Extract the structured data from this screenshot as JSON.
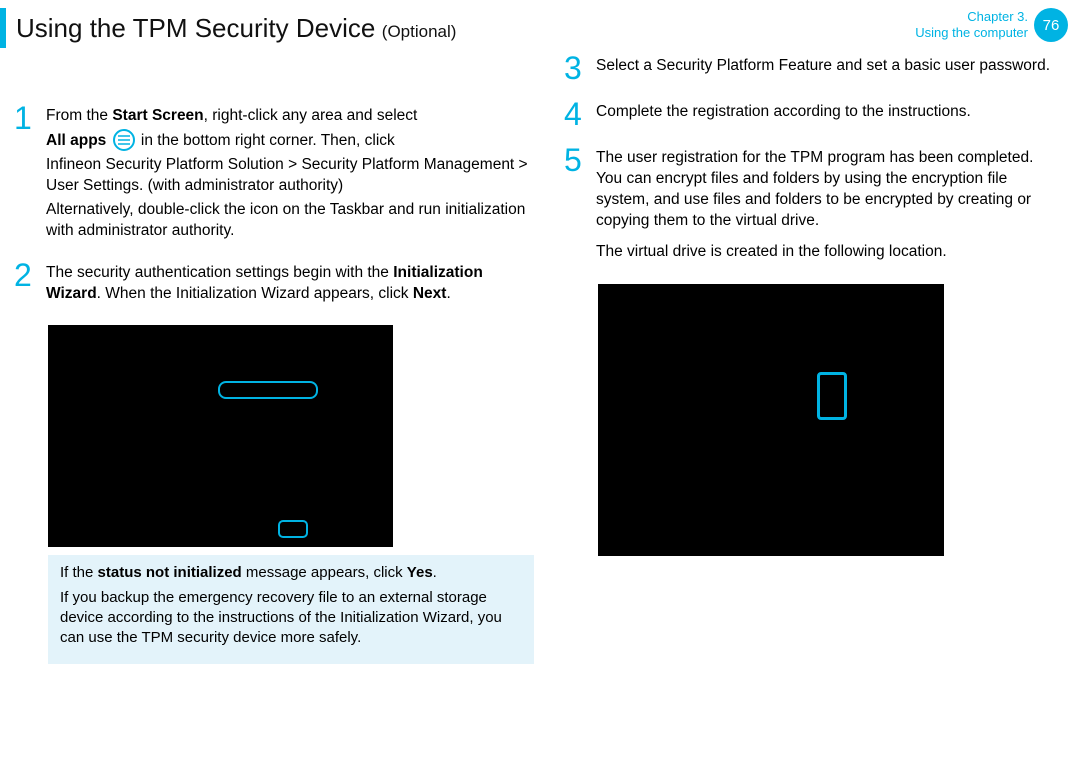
{
  "header": {
    "title_main": "Using the TPM Security Device",
    "title_optional": "(Optional)",
    "chapter_line1": "Chapter 3.",
    "chapter_line2": "Using the computer",
    "page_number": "76"
  },
  "left_steps": {
    "s1": {
      "num": "1",
      "line_a_before": "From the ",
      "line_a_bold": "Start Screen",
      "line_a_after": ", right-click any area and select",
      "line_b_before": "All apps ",
      "line_b_after": " in the bottom right corner. Then, click",
      "line_c": "Inﬁneon Security Platform Solution > Security Platform Management > User Settings. (with administrator authority)",
      "line_d_before": "Alternatively, double-click the ",
      "line_d_after": " icon on the Taskbar and run initialization with administrator authority."
    },
    "s2": {
      "num": "2",
      "line_a_before": "The security authentication settings begin with the ",
      "line_a_bold": "Initialization Wizard",
      "line_a_mid": ". When the Initialization Wizard appears, click ",
      "line_a_bold2": "Next",
      "line_a_end": "."
    }
  },
  "note": {
    "line1_before": "If the ",
    "line1_bold": "status not initialized",
    "line1_mid": " message appears, click ",
    "line1_bold2": "Yes",
    "line1_end": ".",
    "line2": "If you backup the emergency recovery ﬁle to an external storage device according to the instructions of the Initialization Wizard, you can use the TPM security device more safely."
  },
  "right_steps": {
    "s3": {
      "num": "3",
      "text": "Select a Security Platform Feature and set a basic user password."
    },
    "s4": {
      "num": "4",
      "text": "Complete the registration according to the instructions."
    },
    "s5": {
      "num": "5",
      "text1": "The user registration for the TPM program has been completed. You can encrypt ﬁles and folders by using the encryption ﬁle system, and use ﬁles and folders to be encrypted by creating or copying them to the virtual drive.",
      "text2": "The virtual drive is created in the following location."
    }
  }
}
